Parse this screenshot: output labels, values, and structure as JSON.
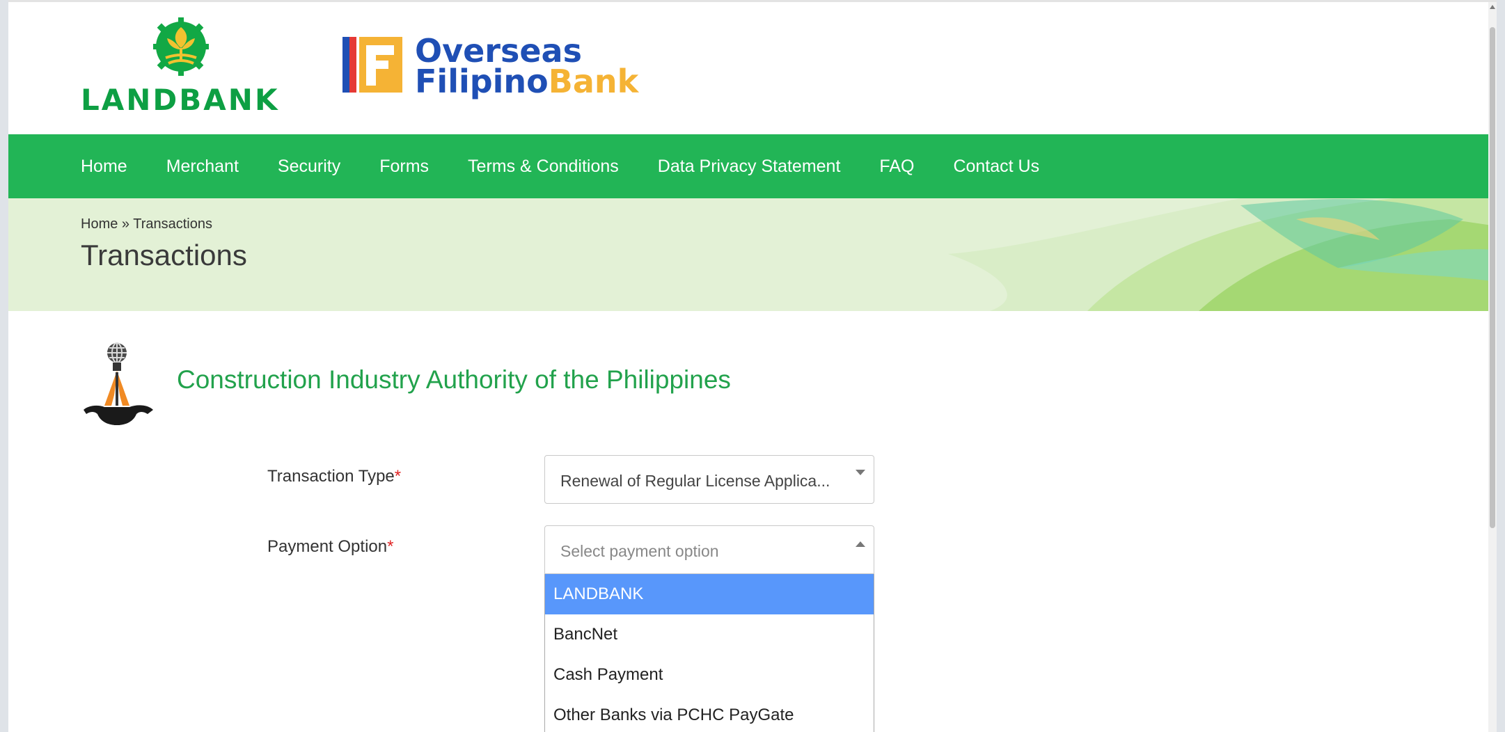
{
  "header": {
    "landbank_logo_text": "LANDBANK",
    "ofb_logo": {
      "line1": "Overseas",
      "line2_a": "Filipino",
      "line2_b": "Bank"
    }
  },
  "nav": {
    "items": [
      {
        "label": "Home"
      },
      {
        "label": "Merchant"
      },
      {
        "label": "Security"
      },
      {
        "label": "Forms"
      },
      {
        "label": "Terms & Conditions"
      },
      {
        "label": "Data Privacy Statement"
      },
      {
        "label": "FAQ"
      },
      {
        "label": "Contact Us"
      }
    ]
  },
  "breadcrumb": {
    "home": "Home",
    "separator": " » ",
    "current": "Transactions"
  },
  "page_title": "Transactions",
  "organization": {
    "name": "Construction Industry Authority of the Philippines"
  },
  "form": {
    "transaction_type": {
      "label": "Transaction Type",
      "required_mark": "*",
      "value": "Renewal of Regular License Applica..."
    },
    "payment_option": {
      "label": "Payment Option",
      "required_mark": "*",
      "placeholder": "Select payment option",
      "options": [
        {
          "label": "LANDBANK"
        },
        {
          "label": "BancNet"
        },
        {
          "label": "Cash Payment"
        },
        {
          "label": "Other Banks via PCHC PayGate"
        }
      ],
      "highlighted_option": "LANDBANK"
    }
  },
  "colors": {
    "nav_green": "#22b556",
    "brand_green": "#0d9f43",
    "org_name_green": "#22a24c",
    "ofb_blue": "#1f4fb5",
    "ofb_yellow": "#f5b335",
    "option_highlight": "#5897fb",
    "required_red": "#e02424"
  },
  "icons": {
    "landbank_emblem": "landbank-emblem-icon",
    "ofb_mark": "ofb-logo-mark-icon",
    "org_logo": "ciap-logo-icon",
    "dropdown_caret": "caret-down-icon"
  }
}
